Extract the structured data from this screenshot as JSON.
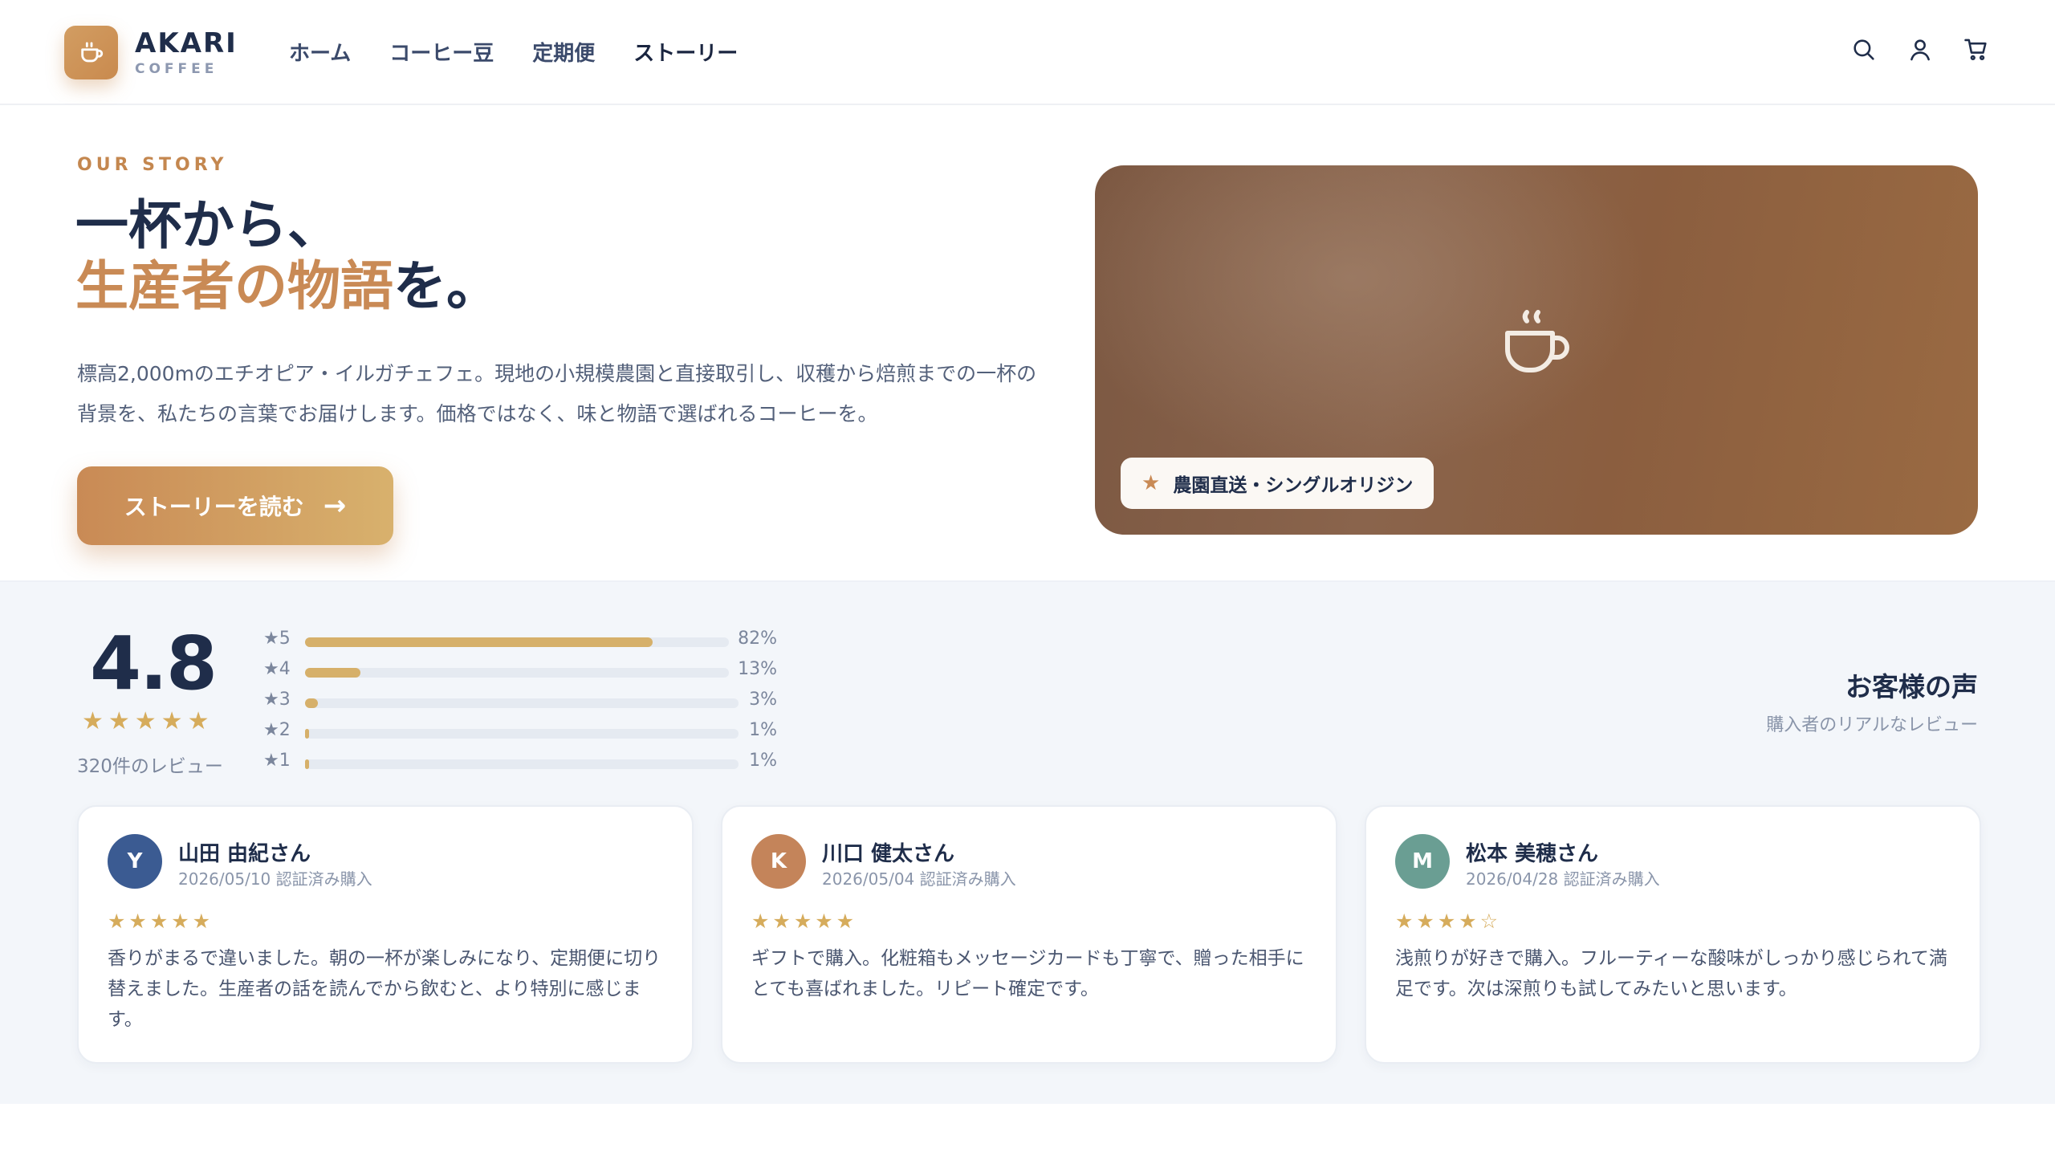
{
  "brand": {
    "name": "AKARI",
    "sub": "COFFEE"
  },
  "nav": {
    "items": [
      {
        "label": "ホーム"
      },
      {
        "label": "コーヒー豆"
      },
      {
        "label": "定期便"
      },
      {
        "label": "ストーリー",
        "active": true
      }
    ]
  },
  "header_icons": [
    "search-icon",
    "user-icon",
    "cart-icon"
  ],
  "hero": {
    "eyebrow": "OUR STORY",
    "title_line1": "一杯から、",
    "title_accent": "生産者の物語",
    "title_end": "を。",
    "description": "標高2,000mのエチオピア・イルガチェフェ。現地の小規模農園と直接取引し、収穫から焙煎までの一杯の背景を、私たちの言葉でお届けします。価格ではなく、味と物語で選ばれるコーヒーを。",
    "cta_label": "ストーリーを読む",
    "cta_arrow": "→",
    "badge_star": "★",
    "badge_text": "農園直送・シングルオリジン"
  },
  "reviews": {
    "average": "4.8",
    "stars": "★★★★★",
    "count_label": "320件のレビュー",
    "distribution": [
      {
        "label": "★5",
        "percent": 82,
        "pct_label": "82%"
      },
      {
        "label": "★4",
        "percent": 13,
        "pct_label": "13%"
      },
      {
        "label": "★3",
        "percent": 3,
        "pct_label": "3%"
      },
      {
        "label": "★2",
        "percent": 1,
        "pct_label": "1%"
      },
      {
        "label": "★1",
        "percent": 1,
        "pct_label": "1%"
      }
    ],
    "section_title": "お客様の声",
    "section_sub": "購入者のリアルなレビュー",
    "cards": [
      {
        "initial": "Y",
        "avatar_color": "#3b5b92",
        "name": "山田 由紀さん",
        "meta": "2026/05/10 認証済み購入",
        "stars": "★★★★★",
        "text": "香りがまるで違いました。朝の一杯が楽しみになり、定期便に切り替えました。生産者の話を読んでから飲むと、より特別に感じます。"
      },
      {
        "initial": "K",
        "avatar_color": "#c4845a",
        "name": "川口 健太さん",
        "meta": "2026/05/04 認証済み購入",
        "stars": "★★★★★",
        "text": "ギフトで購入。化粧箱もメッセージカードも丁寧で、贈った相手にとても喜ばれました。リピート確定です。"
      },
      {
        "initial": "M",
        "avatar_color": "#6a9e93",
        "name": "松本 美穂さん",
        "meta": "2026/04/28 認証済み購入",
        "stars": "★★★★☆",
        "text": "浅煎りが好きで購入。フルーティーな酸味がしっかり感じられて満足です。次は深煎りも試してみたいと思います。"
      }
    ]
  },
  "colors": {
    "accent": "#c98a55",
    "navy": "#1f2d4a",
    "gold": "#d6ac5c",
    "section_bg": "#f3f6fa"
  }
}
